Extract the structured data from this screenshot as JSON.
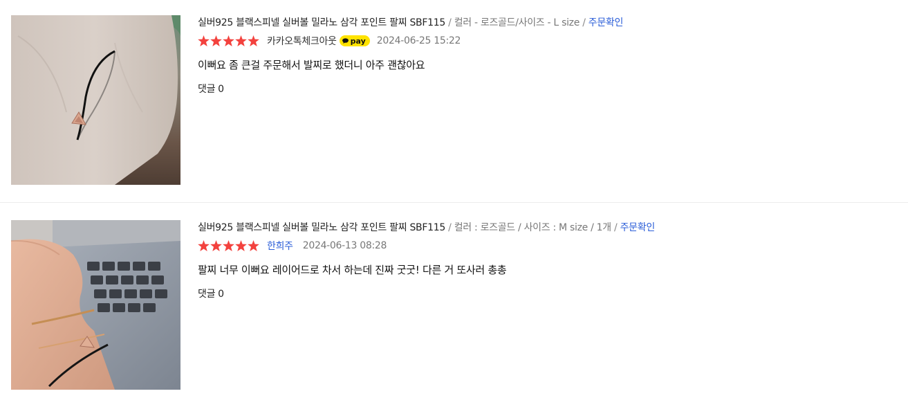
{
  "colors": {
    "star": "#f3423e",
    "link": "#2a5dd8",
    "pay_badge": "#ffe300",
    "divider": "#ececec"
  },
  "reviews": [
    {
      "product_name": "실버925 블랙스피넬 실버볼 밀라노 삼각 포인트 팔찌 SBF115",
      "option": "컬러 - 로즈골드/사이즈 - L size",
      "separator": "/",
      "order_status": "주문확인",
      "rating": 5,
      "author": "카카오톡체크아웃",
      "badge": "pay",
      "badge_icon": "kakao-speech-bubble-icon",
      "date": "2024-06-25 15:22",
      "text": "이뻐요 좀 큰걸 주문해서 발찌로 했더니 아주 괜찮아요",
      "comment_label": "댓글",
      "comment_count": "0",
      "photo": "bracelet-on-wrist-photo"
    },
    {
      "product_name": "실버925 블랙스피넬 실버볼 밀라노 삼각 포인트 팔찌 SBF115",
      "option": "컬러 : 로즈골드 / 사이즈 : M size / 1개",
      "separator": "/",
      "order_status": "주문확인",
      "rating": 5,
      "author": "한희주",
      "date": "2024-06-13 08:28",
      "text": "팔찌 너무 이뻐요 레이어드로 차서 하는데 진짜 굿굿! 다른 거 또사러 총총",
      "comment_label": "댓글",
      "comment_count": "0",
      "photo": "bracelets-on-wrist-over-laptop-photo"
    }
  ]
}
